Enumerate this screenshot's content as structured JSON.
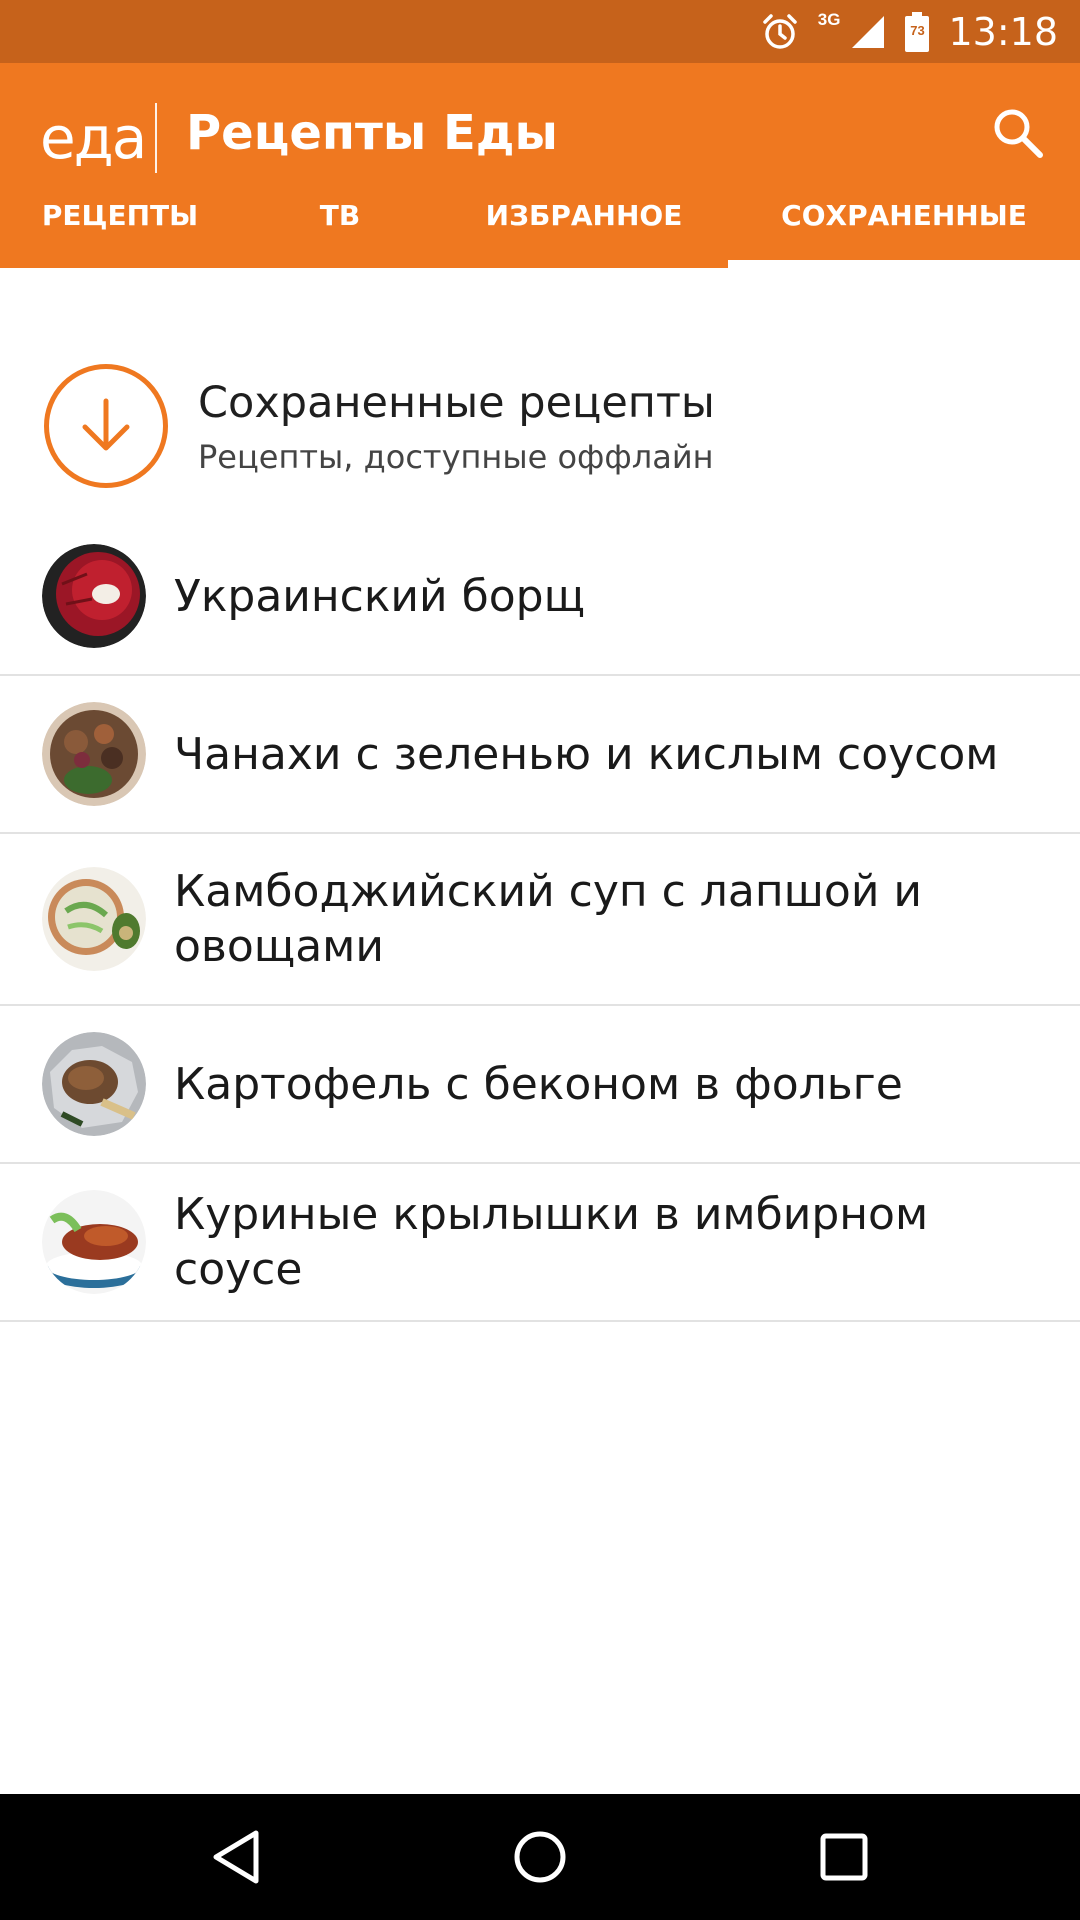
{
  "status_bar": {
    "network": "3G",
    "battery": "73",
    "time": "13:18"
  },
  "app_bar": {
    "logo": "еда",
    "title": "Рецепты Еды"
  },
  "tabs": [
    {
      "label": "РЕЦЕПТЫ",
      "active": false
    },
    {
      "label": "ТВ",
      "active": false
    },
    {
      "label": "ИЗБРАННОЕ",
      "active": false
    },
    {
      "label": "СОХРАНЕННЫЕ",
      "active": true
    }
  ],
  "saved_header": {
    "title": "Сохраненные рецепты",
    "subtitle": "Рецепты, доступные оффлайн"
  },
  "recipes": [
    {
      "name": "Украинский борщ"
    },
    {
      "name": "Чанахи с зеленью и кислым соусом"
    },
    {
      "name": "Камбоджийский суп с лапшой и овощами"
    },
    {
      "name": "Картофель с беконом в фольге"
    },
    {
      "name": "Куриные крылышки в имбирном соусе"
    }
  ],
  "colors": {
    "accent": "#ef7820",
    "status_bar": "#c6621b"
  }
}
